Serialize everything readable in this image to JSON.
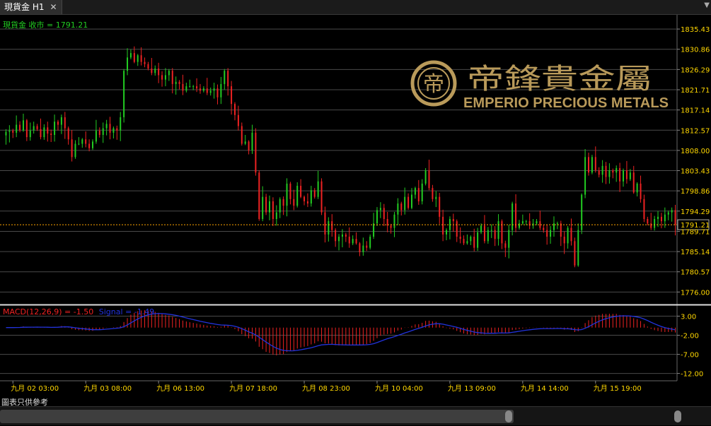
{
  "window": {
    "tab_title": "現貨金 H1",
    "close_glyph": "✕",
    "menu_glyph": "▼"
  },
  "brand": {
    "chinese_name": "帝鋒貴金屬",
    "english_name": "EMPERIO PRECIOUS METALS",
    "logo_glyph": "帝",
    "color": "#b99a5a"
  },
  "footnote": "圖表只供參考",
  "chart_data": [
    {
      "type": "candlestick",
      "title": "現貨金 收市 = 1791.21",
      "symbol": "現貨金",
      "timeframe": "H1",
      "ylim": [
        1773.5,
        1838.0
      ],
      "yticks": [
        "1835.43",
        "1830.86",
        "1826.29",
        "1821.71",
        "1817.14",
        "1812.57",
        "1808.00",
        "1803.43",
        "1798.86",
        "1794.29",
        "1789.71",
        "1785.14",
        "1780.57",
        "1776.00"
      ],
      "current_price_label": "1791.21",
      "current_price": 1791.21,
      "xlabels": [
        "九月 02 03:00",
        "九月 03 08:00",
        "九月 06 13:00",
        "九月 07 18:00",
        "九月 08 23:00",
        "九月 10 04:00",
        "九月 13 09:00",
        "九月 14 14:00",
        "九月 15 19:00"
      ],
      "grid": true,
      "colors": {
        "up": "#22cc22",
        "down": "#ee2222",
        "grid": "#555555",
        "axis_text": "#ffd700",
        "price_line": "#ffa500"
      },
      "close": [
        1812.2,
        1812.5,
        1812.0,
        1813.8,
        1812.5,
        1814.8,
        1811.0,
        1812.5,
        1813.5,
        1812.8,
        1811.0,
        1813.2,
        1811.8,
        1811.5,
        1814.5,
        1813.8,
        1815.5,
        1813.0,
        1810.5,
        1806.5,
        1809.5,
        1809.5,
        1810.5,
        1809.5,
        1808.5,
        1810.0,
        1812.5,
        1811.5,
        1813.0,
        1814.0,
        1812.0,
        1813.0,
        1812.5,
        1815.5,
        1826.0,
        1829.0,
        1830.0,
        1828.0,
        1829.5,
        1828.0,
        1827.5,
        1826.5,
        1825.5,
        1826.5,
        1825.0,
        1824.0,
        1825.0,
        1826.0,
        1823.0,
        1823.5,
        1823.0,
        1821.5,
        1822.5,
        1822.5,
        1822.5,
        1822.0,
        1821.5,
        1822.0,
        1821.0,
        1821.5,
        1822.0,
        1820.0,
        1823.0,
        1826.0,
        1822.5,
        1818.5,
        1816.0,
        1813.5,
        1809.5,
        1810.0,
        1808.0,
        1812.0,
        1803.0,
        1792.5,
        1797.5,
        1794.0,
        1796.5,
        1792.5,
        1794.0,
        1797.0,
        1795.5,
        1800.5,
        1797.0,
        1795.5,
        1800.0,
        1797.5,
        1796.5,
        1796.0,
        1799.0,
        1797.5,
        1801.0,
        1794.0,
        1789.0,
        1792.0,
        1790.0,
        1787.5,
        1788.5,
        1789.0,
        1788.5,
        1787.0,
        1788.0,
        1787.0,
        1785.0,
        1786.5,
        1786.0,
        1788.5,
        1791.5,
        1794.5,
        1795.0,
        1792.5,
        1791.0,
        1790.5,
        1793.5,
        1796.0,
        1794.5,
        1797.5,
        1795.0,
        1798.0,
        1799.5,
        1796.5,
        1800.5,
        1803.5,
        1799.5,
        1797.0,
        1797.5,
        1793.0,
        1789.0,
        1790.0,
        1792.5,
        1792.0,
        1788.5,
        1788.0,
        1787.0,
        1787.5,
        1788.5,
        1786.0,
        1789.5,
        1791.0,
        1787.5,
        1790.0,
        1790.0,
        1788.0,
        1792.0,
        1787.0,
        1786.0,
        1790.0,
        1796.0,
        1790.5,
        1791.5,
        1792.0,
        1792.0,
        1791.0,
        1791.5,
        1792.0,
        1790.5,
        1790.0,
        1788.5,
        1790.0,
        1791.5,
        1791.5,
        1788.5,
        1787.0,
        1790.5,
        1787.5,
        1782.0,
        1790.0,
        1798.0,
        1806.5,
        1803.0,
        1806.5,
        1803.5,
        1802.5,
        1804.5,
        1802.0,
        1803.5,
        1803.0,
        1804.0,
        1801.0,
        1803.5,
        1801.5,
        1803.0,
        1798.5,
        1800.5,
        1797.0,
        1792.5,
        1791.5,
        1790.5,
        1792.5,
        1793.0,
        1792.0,
        1793.5,
        1794.0,
        1794.5,
        1791.2
      ],
      "macd": {
        "label": "MACD(12,26,9) = -1.50",
        "signal_label": "Signal = -1.49",
        "params": [
          12,
          26,
          9
        ],
        "value": -1.5,
        "signal": -1.49,
        "ylim": [
          -13.0,
          5.5
        ],
        "yticks": [
          "3.00",
          "-2.00",
          "-7.00",
          "-12.00"
        ],
        "hist_color": "#ee2222",
        "signal_color": "#2233dd"
      }
    }
  ]
}
